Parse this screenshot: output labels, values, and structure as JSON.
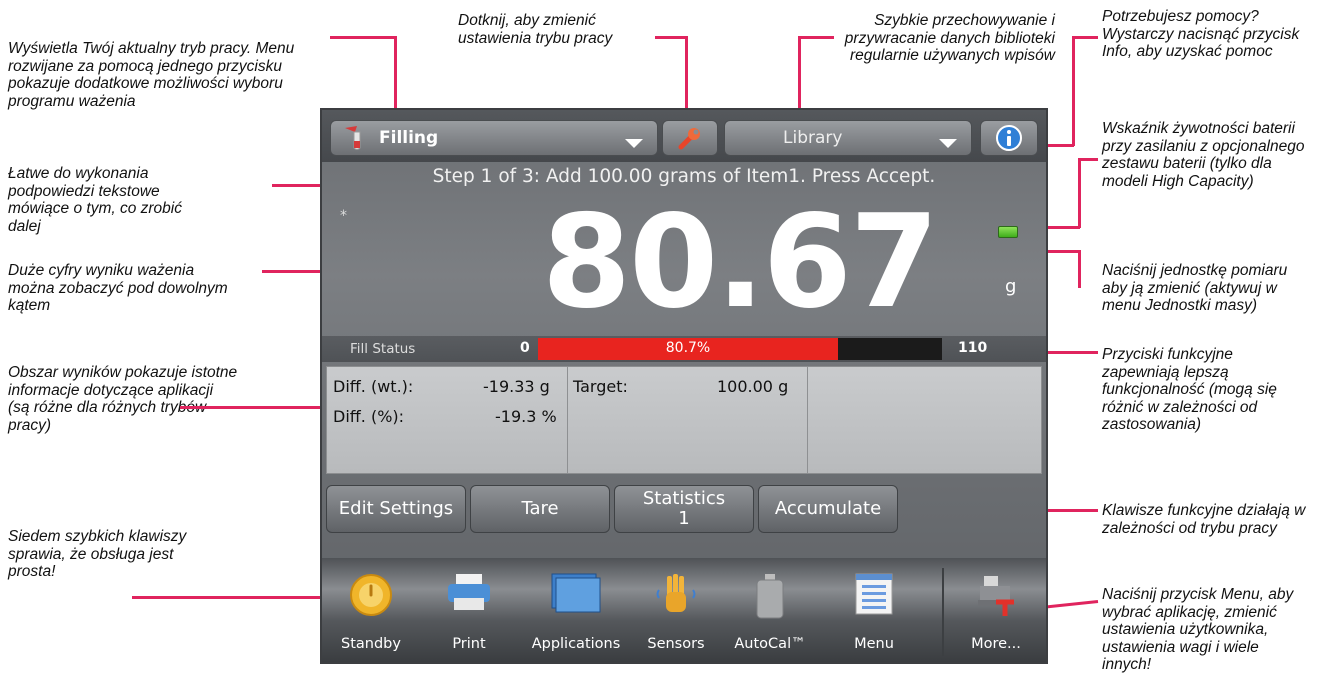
{
  "annotations": {
    "mode": "Wyświetla Twój aktualny tryb pracy. Menu rozwijane za pomocą jednego przycisku pokazuje dodatkowe możliwości wyboru programu ważenia",
    "settings": "Dotknij, aby zmienić ustawienia trybu pracy",
    "library": "Szybkie przechowywanie i przywracanie danych biblioteki regularnie używanych wpisów",
    "help": "Potrzebujesz pomocy? Wystarczy nacisnąć przycisk Info, aby uzyskać pomoc",
    "prompt": "Łatwe do wykonania podpowiedzi tekstowe mówiące o tym, co zrobić dalej",
    "battery": "Wskaźnik żywotności baterii przy zasilaniu z opcjonalnego zestawu baterii (tylko dla modeli High Capacity)",
    "digits": "Duże cyfry wyniku ważenia można zobaczyć pod dowolnym kątem",
    "unit": "Naciśnij jednostkę pomiaru aby ją zmienić (aktywuj w menu Jednostki masy)",
    "results": "Obszar wyników pokazuje istotne informacje dotyczące aplikacji (są różne dla różnych trybów pracy)",
    "function_buttons": "Przyciski funkcyjne zapewniają lepszą funkcjonalność (mogą się różnić w zależności od zastosowania)",
    "function_keys": "Klawisze funkcyjne działają w zależności od trybu pracy",
    "quick_keys": "Siedem szybkich klawiszy sprawia, że obsługa jest prosta!",
    "menu": "Naciśnij przycisk Menu, aby wybrać aplikację, zmienić ustawienia użytkownika, ustawienia wagi i wiele innych!"
  },
  "device": {
    "mode_label": "Filling",
    "library_label": "Library",
    "prompt": "Step 1 of 3: Add 100.00 grams of Item1.  Press Accept.",
    "star": "*",
    "weight": "80.67",
    "unit": "g",
    "fill_status": {
      "label": "Fill Status",
      "min": "0",
      "max": "110",
      "percent_text": "80.7%",
      "fraction": 0.807
    },
    "results": {
      "diff_wt_label": "Diff. (wt.):",
      "diff_wt_value": "-19.33 g",
      "diff_pct_label": "Diff. (%):",
      "diff_pct_value": "-19.3 %",
      "target_label": "Target:",
      "target_value": "100.00 g"
    },
    "function_keys": {
      "edit": "Edit Settings",
      "tare": "Tare",
      "statistics": "Statistics",
      "statistics_count": "1",
      "accumulate": "Accumulate"
    },
    "dock": {
      "standby": "Standby",
      "print": "Print",
      "applications": "Applications",
      "sensors": "Sensors",
      "autocal": "AutoCal™",
      "menu": "Menu",
      "more": "More..."
    }
  },
  "colors": {
    "accent_line": "#e0245e",
    "fill_bar": "#e8241f",
    "battery": "#5ccb2e"
  }
}
